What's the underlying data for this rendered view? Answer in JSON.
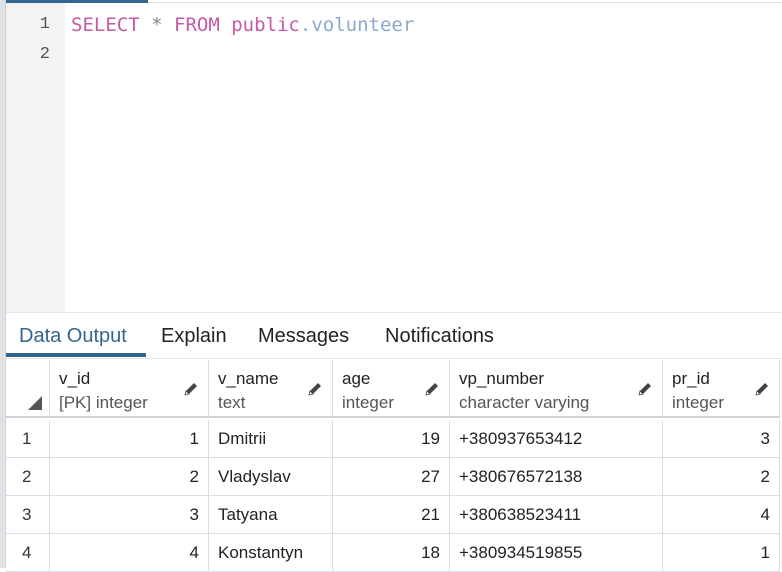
{
  "editor": {
    "line_numbers": [
      "1",
      "2"
    ],
    "query": {
      "select": "SELECT",
      "star": "*",
      "from": "FROM",
      "schema": "public",
      "dot": ".",
      "table": "volunteer"
    }
  },
  "output_tabs": {
    "data_output": "Data Output",
    "explain": "Explain",
    "messages": "Messages",
    "notifications": "Notifications",
    "active": "Data Output"
  },
  "columns": [
    {
      "name": "v_id",
      "type": "[PK] integer"
    },
    {
      "name": "v_name",
      "type": "text"
    },
    {
      "name": "age",
      "type": "integer"
    },
    {
      "name": "vp_number",
      "type": "character varying"
    },
    {
      "name": "pr_id",
      "type": "integer"
    }
  ],
  "rows": [
    {
      "row_num": "1",
      "v_id": "1",
      "v_name": "Dmitrii",
      "age": "19",
      "vp_number": "+380937653412",
      "pr_id": "3"
    },
    {
      "row_num": "2",
      "v_id": "2",
      "v_name": "Vladyslav",
      "age": "27",
      "vp_number": "+380676572138",
      "pr_id": "2"
    },
    {
      "row_num": "3",
      "v_id": "3",
      "v_name": "Tatyana",
      "age": "21",
      "vp_number": "+380638523411",
      "pr_id": "4"
    },
    {
      "row_num": "4",
      "v_id": "4",
      "v_name": "Konstantyn",
      "age": "18",
      "vp_number": "+380934519855",
      "pr_id": "1"
    }
  ],
  "colors": {
    "accent": "#326690",
    "keyword": "#c55aa5",
    "table_name": "#8ba9cc"
  },
  "icons": {
    "column_edit": "pencil-icon",
    "select_all": "select-all-triangle-icon"
  }
}
